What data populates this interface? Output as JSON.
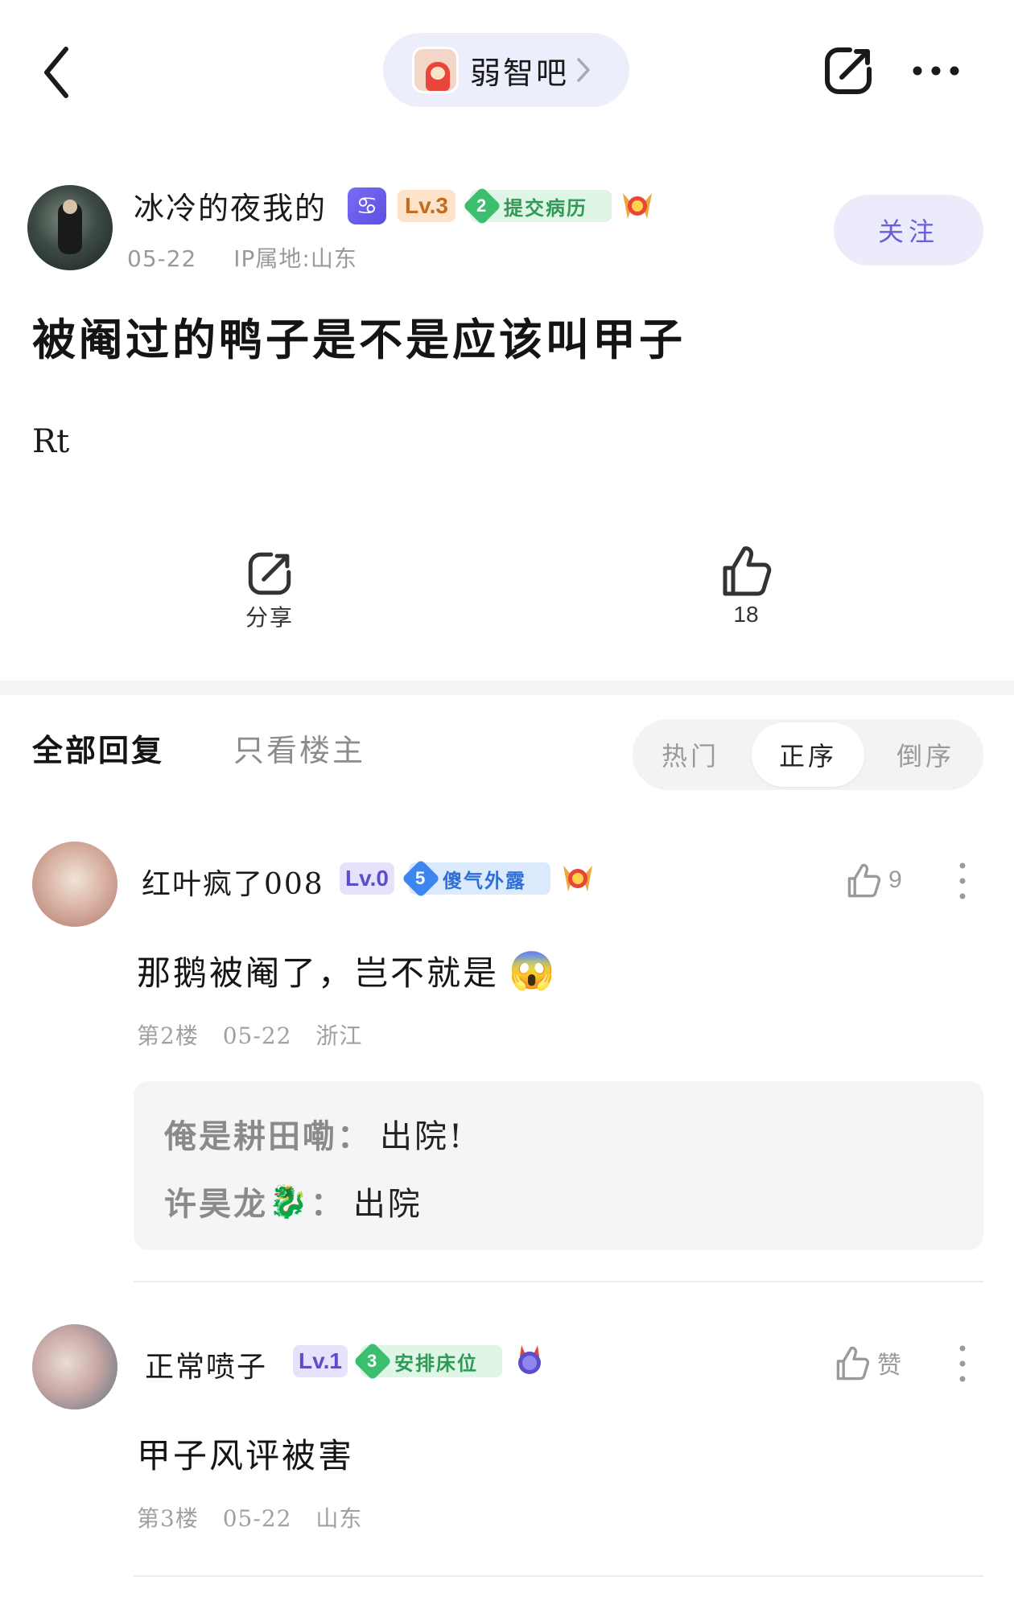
{
  "header": {
    "forum_name": "弱智吧"
  },
  "post": {
    "author": "冰冷的夜我的",
    "zodiac_glyph": "♋",
    "level": "Lv.3",
    "title_badge_num": "2",
    "title_badge_text": "提交病历",
    "medal_icon": "medal-icon",
    "date": "05-22",
    "ip": "IP属地:山东",
    "follow_label": "关注",
    "title": "被阉过的鸭子是不是应该叫甲子",
    "body": "Rt",
    "share_label": "分享",
    "like_count": "18"
  },
  "tabs": {
    "all": "全部回复",
    "op_only": "只看楼主",
    "sort": [
      "热门",
      "正序",
      "倒序"
    ],
    "sort_active": "正序"
  },
  "replies": [
    {
      "author": "红叶疯了008",
      "level": "Lv.0",
      "badge_num": "5",
      "badge_text": "傻气外露",
      "like": "9",
      "content": "那鹅被阉了，岂不就是",
      "emoji": "😱",
      "floor": "第2楼",
      "date": "05-22",
      "location": "浙江",
      "sub_replies": [
        {
          "user": "俺是耕田嘞",
          "sep": "：",
          "text": "出院!"
        },
        {
          "user": "许昊龙",
          "emoji": "🐉",
          "sep": "：",
          "text": "出院"
        }
      ]
    },
    {
      "author": "正常喷子",
      "level": "Lv.1",
      "badge_num": "3",
      "badge_text": "安排床位",
      "like": "赞",
      "content": "甲子风评被害",
      "floor": "第3楼",
      "date": "05-22",
      "location": "山东"
    }
  ],
  "colors": {
    "accent": "#6a5fd8",
    "follow_bg": "#ecebfb",
    "forum_pill_bg": "#edeefc",
    "muted": "#9a9a9a"
  }
}
